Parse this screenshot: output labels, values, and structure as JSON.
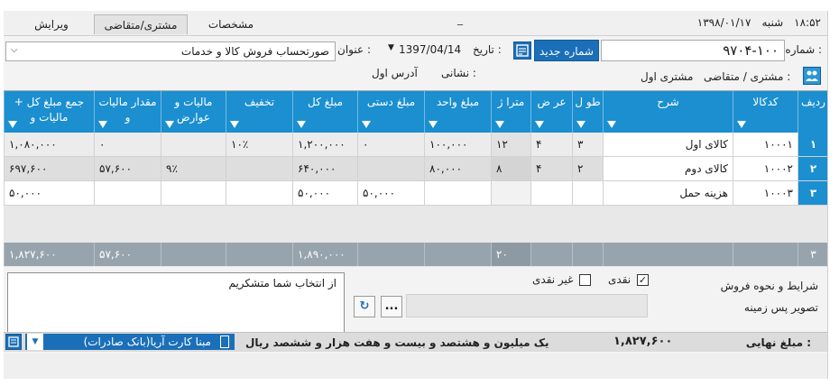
{
  "topbar": {
    "tabs": [
      {
        "label": "مشخصات"
      },
      {
        "label": "مشتری/متقاضی"
      },
      {
        "label": "ویرایش"
      }
    ],
    "minimize": "_",
    "time": "۱۸:۵۲",
    "day": "شنبه",
    "date": "۱۳۹۸/۰۱/۱۷"
  },
  "header": {
    "number_label": "شماره :",
    "number_value": "۹۷۰۴-۱۰۰",
    "new_number_button": "شماره جدید",
    "date_label": "تاریخ :",
    "date_value": "1397/04/14",
    "title_label": "عنوان :",
    "title_value": "صورتحساب فروش کالا و خدمات",
    "customer_label": "مشتری / متقاضی :",
    "customer_value": "مشتری اول",
    "address_label": "نشانی :",
    "address_value": "آدرس اول"
  },
  "grid": {
    "columns": [
      {
        "label": "ردیف"
      },
      {
        "label": "کدکالا"
      },
      {
        "label": "شرح"
      },
      {
        "label": "طو ل"
      },
      {
        "label": "عر ض"
      },
      {
        "label": "مترا ژ"
      },
      {
        "label": "مبلغ واحد"
      },
      {
        "label": "مبلغ دستی"
      },
      {
        "label": "مبلغ کل"
      },
      {
        "label": "تخفیف"
      },
      {
        "label": "مالیات و عوارض"
      },
      {
        "label": "مقدار مالیات و"
      },
      {
        "label": "جمع مبلغ کل + مالیات و"
      }
    ],
    "rows": [
      {
        "row": "۱",
        "code": "۱۰۰۰۱",
        "desc": "کالای اول",
        "length": "۳",
        "width": "۴",
        "area": "۱۲",
        "unit": "۱۰۰,۰۰۰",
        "manual": "۰",
        "total": "۱,۲۰۰,۰۰۰",
        "discount": "۱۰٪",
        "tax_rate": "",
        "tax_amount": "۰",
        "grand": "۱,۰۸۰,۰۰۰"
      },
      {
        "row": "۲",
        "code": "۱۰۰۰۲",
        "desc": "کالای دوم",
        "length": "۲",
        "width": "۴",
        "area": "۸",
        "unit": "۸۰,۰۰۰",
        "manual": "",
        "total": "۶۴۰,۰۰۰",
        "discount": "",
        "tax_rate": "۹٪",
        "tax_amount": "۵۷,۶۰۰",
        "grand": "۶۹۷,۶۰۰"
      },
      {
        "row": "۳",
        "code": "۱۰۰۰۳",
        "desc": "هزینه حمل",
        "length": "",
        "width": "",
        "area": "",
        "unit": "",
        "manual": "۵۰,۰۰۰",
        "total": "۵۰,۰۰۰",
        "discount": "",
        "tax_rate": "",
        "tax_amount": "",
        "grand": "۵۰,۰۰۰"
      }
    ],
    "totals": {
      "count": "۳",
      "area": "۲۰",
      "total": "۱,۸۹۰,۰۰۰",
      "tax_amount": "۵۷,۶۰۰",
      "grand": "۱,۸۲۷,۶۰۰"
    }
  },
  "bottom": {
    "memo_text": "از انتخاب شما متشکریم",
    "sale_terms_label": "شرایط و نحوه فروش",
    "cash_label": "نقدی",
    "noncash_label": "غیر نقدی",
    "cash_checked": "✓",
    "background_image_label": "تصویر پس زمینه",
    "browse_button": "...",
    "final_amount_label": "مبلغ نهایی :",
    "final_amount_value": "۱,۸۲۷,۶۰۰",
    "amount_words": "یک میلیون و هشتصد و بیست و هفت هزار و ششصد ریال",
    "bank_value": "مبنا کارت آریا(بانک صادرات)"
  },
  "colors": {
    "grid_header": "#1b8fd0",
    "button_blue": "#1b6fb8",
    "totals_row": "#98a4ad"
  }
}
